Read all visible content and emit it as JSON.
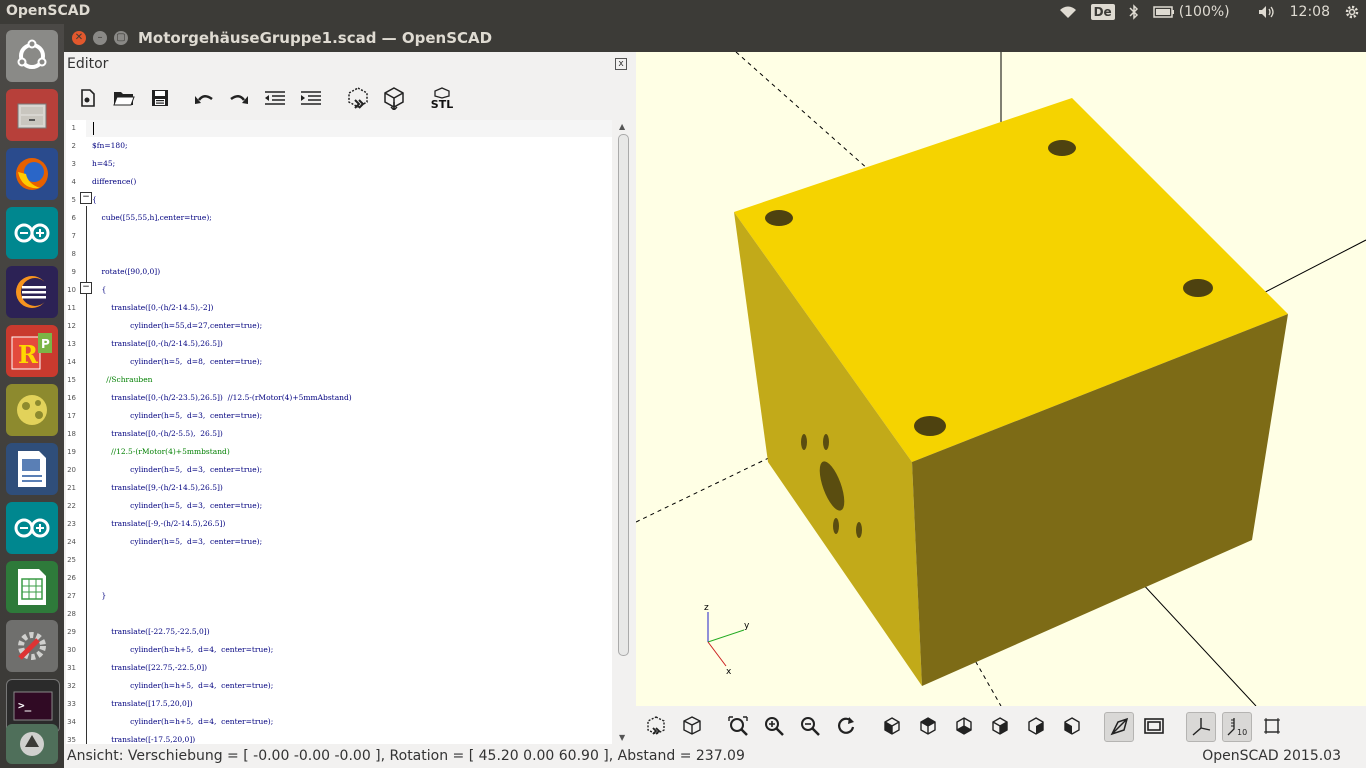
{
  "topbar": {
    "app_name": "OpenSCAD",
    "keyboard_layout": "De",
    "battery": "(100%)",
    "clock": "12:08"
  },
  "launcher": {
    "items": [
      "ubuntu-dash-icon",
      "files-icon",
      "firefox-icon",
      "arduino-icon",
      "eclipse-icon",
      "rubymine-icon",
      "openscad-icon",
      "libreoffice-impress-icon",
      "arduino-icon",
      "libreoffice-calc-icon",
      "system-settings-icon",
      "terminal-icon",
      "software-updater-icon"
    ]
  },
  "window": {
    "title": "MotorgehäuseGruppe1.scad — OpenSCAD"
  },
  "editor": {
    "title": "Editor",
    "close": "x",
    "lines": [
      {
        "n": "1",
        "t": ""
      },
      {
        "n": "2",
        "t": "$fn=180;"
      },
      {
        "n": "3",
        "t": "h=45;"
      },
      {
        "n": "4",
        "t": "difference()"
      },
      {
        "n": "5",
        "t": "{"
      },
      {
        "n": "6",
        "t": "    cube([55,55,h],center=true);"
      },
      {
        "n": "7",
        "t": ""
      },
      {
        "n": "8",
        "t": ""
      },
      {
        "n": "9",
        "t": "    rotate([90,0,0])"
      },
      {
        "n": "10",
        "t": "    {"
      },
      {
        "n": "11",
        "t": "        translate([0,-(h/2-14.5),-2])"
      },
      {
        "n": "12",
        "t": "                cylinder(h=55,d=27,center=true);"
      },
      {
        "n": "13",
        "t": "        translate([0,-(h/2-14.5),26.5])"
      },
      {
        "n": "14",
        "t": "                cylinder(h=5,  d=8,  center=true);"
      },
      {
        "n": "15",
        "t": "      //Schrauben"
      },
      {
        "n": "16",
        "t": "        translate([0,-(h/2-23.5),26.5])  //12.5-(rMotor(4)+5mmAbstand)"
      },
      {
        "n": "17",
        "t": "                cylinder(h=5,  d=3,  center=true);"
      },
      {
        "n": "18",
        "t": "        translate([0,-(h/2-5.5),  26.5])"
      },
      {
        "n": "19",
        "t": "        //12.5-(rMotor(4)+5mmbstand)"
      },
      {
        "n": "20",
        "t": "                cylinder(h=5,  d=3,  center=true);"
      },
      {
        "n": "21",
        "t": "        translate([9,-(h/2-14.5),26.5])"
      },
      {
        "n": "22",
        "t": "                cylinder(h=5,  d=3,  center=true);"
      },
      {
        "n": "23",
        "t": "        translate([-9,-(h/2-14.5),26.5])"
      },
      {
        "n": "24",
        "t": "                cylinder(h=5,  d=3,  center=true);"
      },
      {
        "n": "25",
        "t": ""
      },
      {
        "n": "26",
        "t": ""
      },
      {
        "n": "27",
        "t": "    }"
      },
      {
        "n": "28",
        "t": ""
      },
      {
        "n": "29",
        "t": "        translate([-22.75,-22.5,0])"
      },
      {
        "n": "30",
        "t": "                cylinder(h=h+5,  d=4,  center=true);"
      },
      {
        "n": "31",
        "t": "        translate([22.75,-22.5,0])"
      },
      {
        "n": "32",
        "t": "                cylinder(h=h+5,  d=4,  center=true);"
      },
      {
        "n": "33",
        "t": "        translate([17.5,20,0])"
      },
      {
        "n": "34",
        "t": "                cylinder(h=h+5,  d=4,  center=true);"
      },
      {
        "n": "35",
        "t": "        translate([-17.5,20,0])"
      }
    ]
  },
  "editor_toolbar": [
    "new-file-icon",
    "open-file-icon",
    "save-file-icon",
    "undo-icon",
    "redo-icon",
    "unindent-icon",
    "indent-icon",
    "preview-icon",
    "render-icon",
    "export-stl-icon"
  ],
  "stl_label": "STL",
  "viewport_toolbar": [
    "preview-icon",
    "render-icon",
    "view-all-icon",
    "zoom-in-icon",
    "zoom-out-icon",
    "reset-view-icon",
    "view-right-icon",
    "view-top-icon",
    "view-bottom-icon",
    "view-left-icon",
    "view-front-icon",
    "view-back-icon",
    "perspective-icon",
    "orthogonal-icon",
    "show-axes-icon",
    "show-scale-icon",
    "show-edges-icon"
  ],
  "axis_labels": {
    "z": "z",
    "y": "y",
    "x": "x"
  },
  "scale_label": "10",
  "model": {
    "color": "#f5d300",
    "background": "#ffffe5"
  },
  "status": {
    "text": "Ansicht: Verschiebung = [ -0.00 -0.00 -0.00 ], Rotation = [ 45.20 0.00 60.90 ], Abstand = 237.09",
    "version": "OpenSCAD 2015.03"
  }
}
